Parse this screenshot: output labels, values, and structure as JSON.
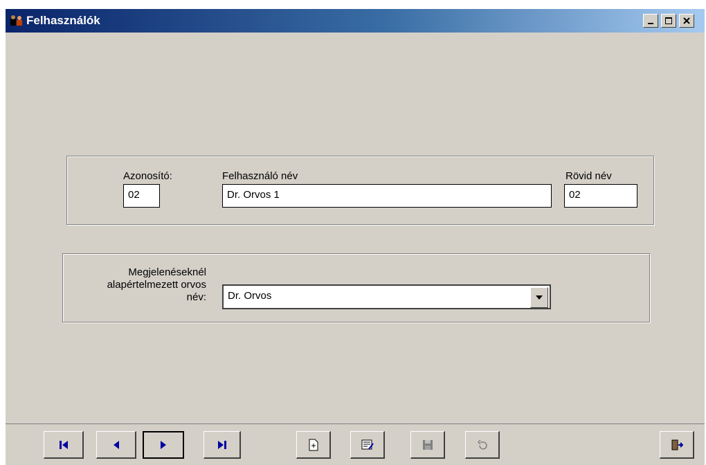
{
  "window": {
    "title": "Felhasználók"
  },
  "title_buttons": {
    "minimize_icon": "minimize-icon",
    "maximize_icon": "maximize-icon",
    "close_icon": "close-icon"
  },
  "user_panel": {
    "id_label": "Azonosító:",
    "id_value": "02",
    "name_label": "Felhasználó név",
    "name_value": "Dr. Orvos 1",
    "short_label": "Rövid név",
    "short_value": "02"
  },
  "default_doctor_panel": {
    "label_line1": "Megjelenéseknél",
    "label_line2": "alapértelmezett orvos",
    "label_line3": "név:",
    "selected": "Dr. Orvos"
  },
  "toolbar": {
    "buttons": [
      "first-record-icon",
      "previous-record-icon",
      "next-record-icon",
      "last-record-icon",
      "new-record-icon",
      "edit-record-icon",
      "save-icon",
      "undo-icon",
      "exit-icon"
    ]
  },
  "colors": {
    "face": "#d4d0c8",
    "title_start": "#0a246a",
    "title_end": "#a6caf0",
    "icon_blue": "#0000a0"
  }
}
